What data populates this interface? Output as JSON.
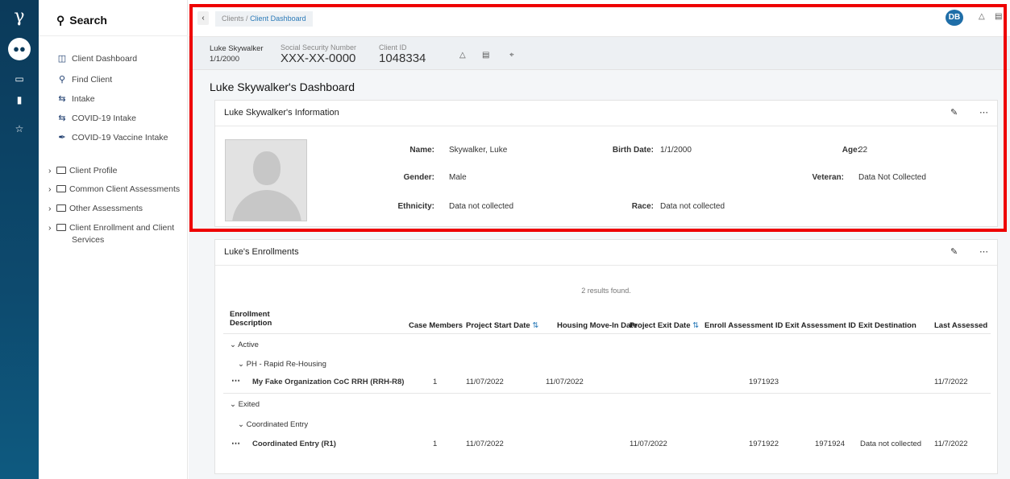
{
  "rail": {
    "logo": "γ",
    "icons": [
      "users-icon",
      "id-card-icon",
      "document-icon",
      "star-icon"
    ]
  },
  "sidebar": {
    "search_label": "Search",
    "items": [
      {
        "label": "Client Dashboard",
        "icon": "dashboard-icon"
      },
      {
        "label": "Find Client",
        "icon": "search-icon"
      },
      {
        "label": "Intake",
        "icon": "swap-icon"
      },
      {
        "label": "COVID-19 Intake",
        "icon": "swap-icon"
      },
      {
        "label": "COVID-19 Vaccine Intake",
        "icon": "syringe-icon"
      }
    ],
    "folders": [
      {
        "label": "Client Profile"
      },
      {
        "label": "Common Client Assessments"
      },
      {
        "label": "Other Assessments"
      },
      {
        "label": "Client Enrollment and Client",
        "label2": "Services"
      }
    ]
  },
  "topbar": {
    "breadcrumb_root": "Clients",
    "breadcrumb_sep": "/",
    "breadcrumb_current": "Client Dashboard",
    "user_initials": "DB"
  },
  "client": {
    "name": "Luke Skywalker",
    "dob": "1/1/2000",
    "ssn_label": "Social Security Number",
    "ssn": "XXX-XX-0000",
    "id_label": "Client ID",
    "id": "1048334"
  },
  "dashboard_title": "Luke Skywalker's Dashboard",
  "info": {
    "title": "Luke Skywalker's Information",
    "name_label": "Name:",
    "name": "Skywalker, Luke",
    "birth_label": "Birth Date:",
    "birth": "1/1/2000",
    "age_label": "Age:",
    "age": "22",
    "gender_label": "Gender:",
    "gender": "Male",
    "veteran_label": "Veteran:",
    "veteran": "Data Not Collected",
    "ethnicity_label": "Ethnicity:",
    "ethnicity": "Data not collected",
    "race_label": "Race:",
    "race": "Data not collected"
  },
  "enrollments": {
    "title": "Luke's Enrollments",
    "results": "2 results found.",
    "headers": {
      "desc1": "Enrollment",
      "desc2": "Description",
      "case_members": "Case Members",
      "start": "Project Start Date",
      "move_in": "Housing Move-In Date",
      "exit": "Project Exit Date",
      "enroll_id": "Enroll Assessment ID",
      "exit_id": "Exit Assessment ID",
      "destination": "Exit Destination",
      "last": "Last Assessed"
    },
    "groups": {
      "active": "Active",
      "active_sub": "PH - Rapid Re-Housing",
      "exited": "Exited",
      "exited_sub": "Coordinated Entry"
    },
    "rows": [
      {
        "desc": "My Fake Organization CoC RRH (RRH-R8)",
        "members": "1",
        "start": "11/07/2022",
        "move_in": "11/07/2022",
        "exit": "",
        "enroll_id": "1971923",
        "exit_id": "",
        "destination": "",
        "last": "11/7/2022"
      },
      {
        "desc": "Coordinated Entry (R1)",
        "members": "1",
        "start": "11/07/2022",
        "move_in": "",
        "exit": "11/07/2022",
        "enroll_id": "1971922",
        "exit_id": "1971924",
        "destination": "Data not collected",
        "last": "11/7/2022"
      }
    ]
  },
  "highlight_color": "#ee0000"
}
